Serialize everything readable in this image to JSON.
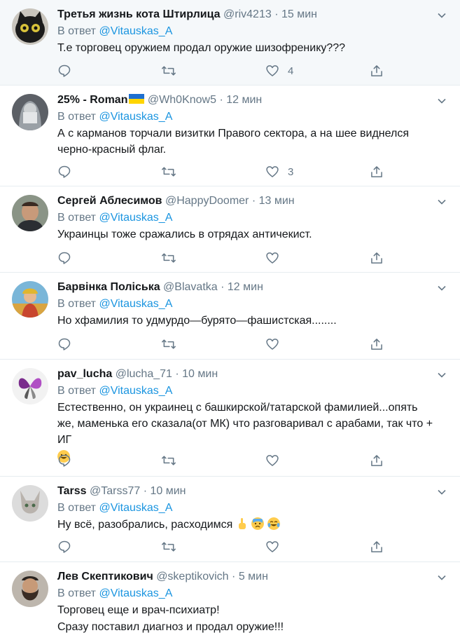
{
  "reply_prefix": "В ответ",
  "tweets": [
    {
      "name": "Третья жизнь кота Штирлица",
      "handle": "@riv4213",
      "dot": "·",
      "time": "15 мин",
      "mention": "@Vitauskas_A",
      "text": "Т.е торговец оружием продал оружие шизофренику???",
      "likes": "4"
    },
    {
      "name": "25% - Roman",
      "handle": "@Wh0Know5",
      "dot": "·",
      "time": "12 мин",
      "mention": "@Vitauskas_A",
      "text": "А с карманов торчали визитки Правого сектора, а на шее виднелся черно-красный флаг.",
      "likes": "3"
    },
    {
      "name": "Сергей Аблесимов",
      "handle": "@HappyDoomer",
      "dot": "·",
      "time": "13 мин",
      "mention": "@Vitauskas_A",
      "text": "Украинцы тоже сражались в отрядах античекист.",
      "likes": ""
    },
    {
      "name": "Барвінка Поліська",
      "handle": "@Blavatka",
      "dot": "·",
      "time": "12 мин",
      "mention": "@Vitauskas_A",
      "text": "Но хфамилия то удмурдо—бурято—фашистская........",
      "likes": ""
    },
    {
      "name": "pav_lucha",
      "handle": "@lucha_71",
      "dot": "·",
      "time": "10 мин",
      "mention": "@Vitauskas_A",
      "text": "Естественно, он украинец с башкирской/татарской фамилией...опять же, маменька его сказала(от МК) что разговаривал с арабами, так что + ИГ",
      "likes": ""
    },
    {
      "name": "Tarss",
      "handle": "@Tarss77",
      "dot": "·",
      "time": "10 мин",
      "mention": "@Vitauskas_A",
      "text": "Ну всё, разобрались, расходимся",
      "likes": ""
    },
    {
      "name": "Лев Скептикович",
      "handle": "@skeptikovich",
      "dot": "·",
      "time": "5 мин",
      "mention": "@Vitauskas_A",
      "text": "Торговец еще и врач-психиатр!",
      "text2": "Сразу поставил диагноз и продал оружие!!!",
      "likes": ""
    }
  ]
}
